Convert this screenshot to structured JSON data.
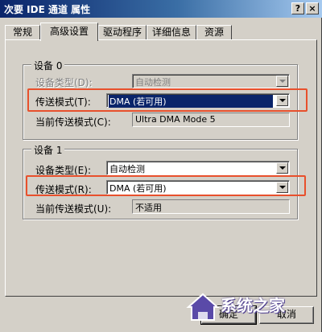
{
  "window": {
    "title": "次要 IDE 通道 属性",
    "help_label": "?",
    "close_label": "×"
  },
  "tabs": [
    {
      "label": "常规",
      "active": false
    },
    {
      "label": "高级设置",
      "active": true
    },
    {
      "label": "驱动程序",
      "active": false
    },
    {
      "label": "详细信息",
      "active": false
    },
    {
      "label": "资源",
      "active": false
    }
  ],
  "device0": {
    "group_title": "设备 0",
    "type_label": "设备类型(D):",
    "type_value": "自动检测",
    "mode_label": "传送模式(T):",
    "mode_value": "DMA (若可用)",
    "current_label": "当前传送模式(C):",
    "current_value": "Ultra DMA Mode 5"
  },
  "device1": {
    "group_title": "设备 1",
    "type_label": "设备类型(E):",
    "type_value": "自动检测",
    "mode_label": "传送模式(R):",
    "mode_value": "DMA (若可用)",
    "current_label": "当前传送模式(U):",
    "current_value": "不适用"
  },
  "buttons": {
    "ok_label": "确定",
    "cancel_label": "取消"
  },
  "watermark": {
    "text": "系统之家"
  },
  "colors": {
    "highlight": "#e8502c",
    "selection": "#0a246a",
    "titlebar": "#0a246a"
  }
}
